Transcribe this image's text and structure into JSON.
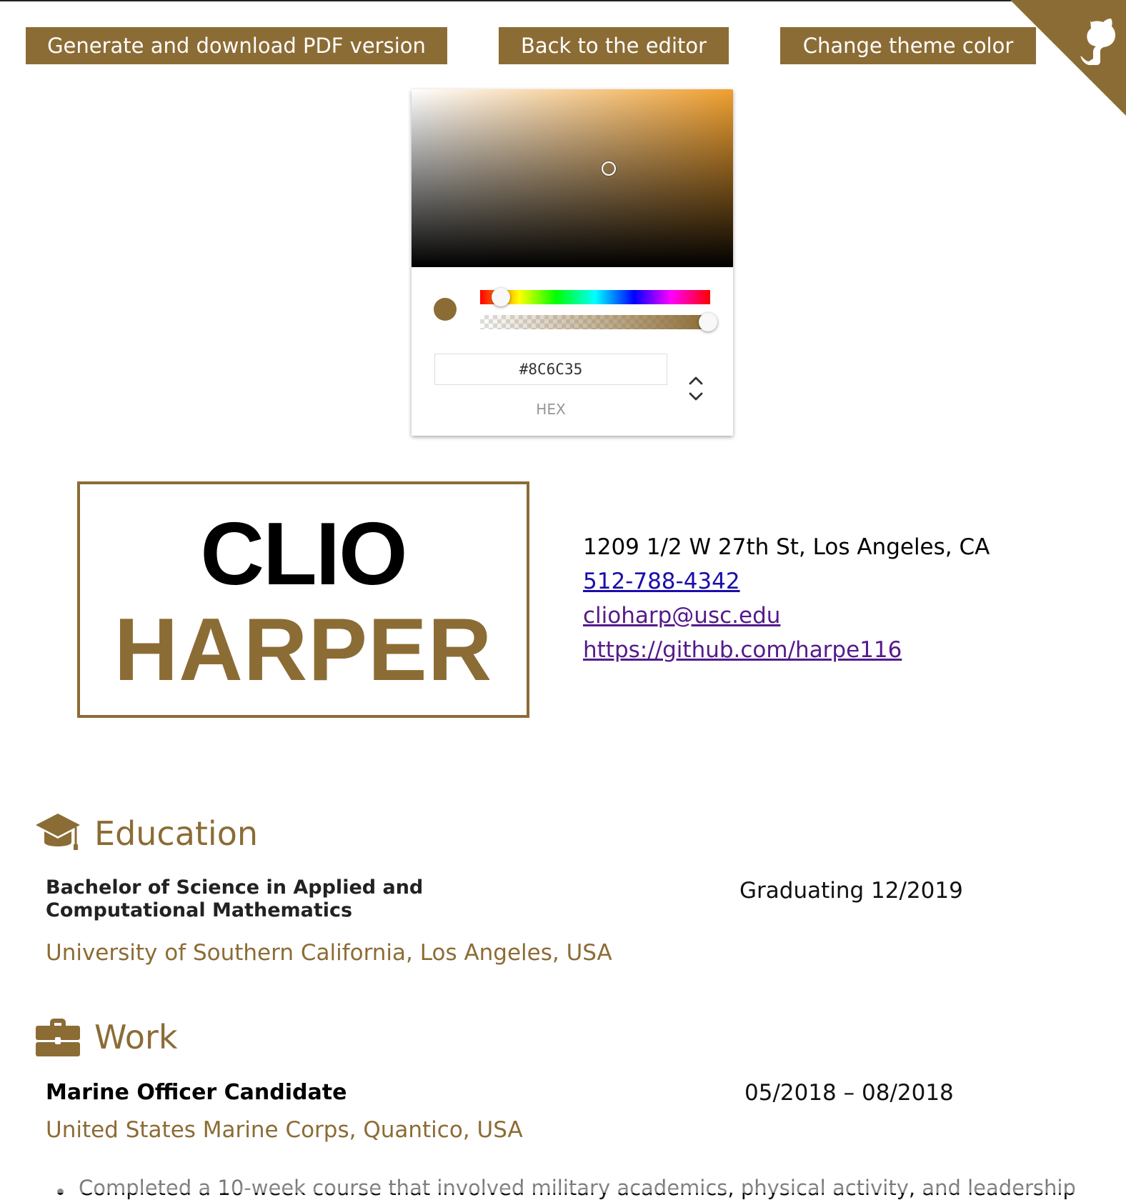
{
  "toolbar": {
    "pdf_label": "Generate and download PDF version",
    "editor_label": "Back to the editor",
    "theme_label": "Change theme color"
  },
  "color_picker": {
    "hex_value": "#8C6C35",
    "mode_label": "HEX",
    "hue_icon": "hue-slider",
    "alpha_icon": "alpha-slider"
  },
  "theme": {
    "accent": "#8c6c35",
    "link": "#1a0dab",
    "visited_link": "#551a8b"
  },
  "header": {
    "first_name": "CLIO",
    "last_name": "HARPER",
    "address": "1209 1/2 W 27th St, Los Angeles, CA",
    "phone": "512-788-4342",
    "email": "clioharp@usc.edu",
    "github": "https://github.com/harpe116"
  },
  "education": {
    "title": "Education",
    "icon": "graduation-cap-icon",
    "degree": "Bachelor of Science in Applied and Computational Mathematics",
    "school": "University of Southern California, Los Angeles, USA",
    "date": "Graduating 12/2019"
  },
  "work": {
    "title": "Work",
    "icon": "briefcase-icon",
    "position": "Marine Officer Candidate",
    "organization": "United States Marine Corps, Quantico, USA",
    "dates": "05/2018 – 08/2018",
    "bullet_1": "Completed a 10-week course that involved military academics, physical activity, and leadership"
  },
  "corner": {
    "icon": "github-octocat-icon"
  }
}
